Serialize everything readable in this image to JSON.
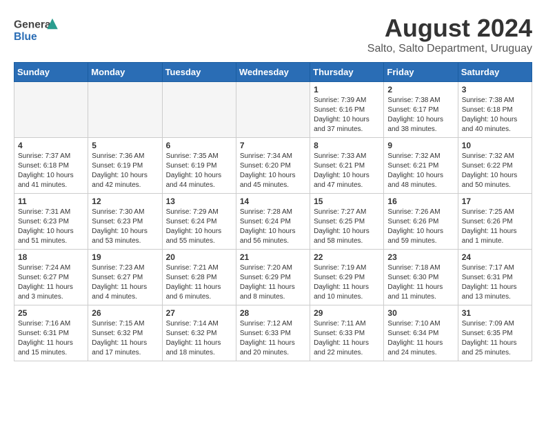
{
  "header": {
    "logo_general": "General",
    "logo_blue": "Blue",
    "title": "August 2024",
    "subtitle": "Salto, Salto Department, Uruguay"
  },
  "weekdays": [
    "Sunday",
    "Monday",
    "Tuesday",
    "Wednesday",
    "Thursday",
    "Friday",
    "Saturday"
  ],
  "weeks": [
    [
      {
        "day": "",
        "info": ""
      },
      {
        "day": "",
        "info": ""
      },
      {
        "day": "",
        "info": ""
      },
      {
        "day": "",
        "info": ""
      },
      {
        "day": "1",
        "info": "Sunrise: 7:39 AM\nSunset: 6:16 PM\nDaylight: 10 hours\nand 37 minutes."
      },
      {
        "day": "2",
        "info": "Sunrise: 7:38 AM\nSunset: 6:17 PM\nDaylight: 10 hours\nand 38 minutes."
      },
      {
        "day": "3",
        "info": "Sunrise: 7:38 AM\nSunset: 6:18 PM\nDaylight: 10 hours\nand 40 minutes."
      }
    ],
    [
      {
        "day": "4",
        "info": "Sunrise: 7:37 AM\nSunset: 6:18 PM\nDaylight: 10 hours\nand 41 minutes."
      },
      {
        "day": "5",
        "info": "Sunrise: 7:36 AM\nSunset: 6:19 PM\nDaylight: 10 hours\nand 42 minutes."
      },
      {
        "day": "6",
        "info": "Sunrise: 7:35 AM\nSunset: 6:19 PM\nDaylight: 10 hours\nand 44 minutes."
      },
      {
        "day": "7",
        "info": "Sunrise: 7:34 AM\nSunset: 6:20 PM\nDaylight: 10 hours\nand 45 minutes."
      },
      {
        "day": "8",
        "info": "Sunrise: 7:33 AM\nSunset: 6:21 PM\nDaylight: 10 hours\nand 47 minutes."
      },
      {
        "day": "9",
        "info": "Sunrise: 7:32 AM\nSunset: 6:21 PM\nDaylight: 10 hours\nand 48 minutes."
      },
      {
        "day": "10",
        "info": "Sunrise: 7:32 AM\nSunset: 6:22 PM\nDaylight: 10 hours\nand 50 minutes."
      }
    ],
    [
      {
        "day": "11",
        "info": "Sunrise: 7:31 AM\nSunset: 6:23 PM\nDaylight: 10 hours\nand 51 minutes."
      },
      {
        "day": "12",
        "info": "Sunrise: 7:30 AM\nSunset: 6:23 PM\nDaylight: 10 hours\nand 53 minutes."
      },
      {
        "day": "13",
        "info": "Sunrise: 7:29 AM\nSunset: 6:24 PM\nDaylight: 10 hours\nand 55 minutes."
      },
      {
        "day": "14",
        "info": "Sunrise: 7:28 AM\nSunset: 6:24 PM\nDaylight: 10 hours\nand 56 minutes."
      },
      {
        "day": "15",
        "info": "Sunrise: 7:27 AM\nSunset: 6:25 PM\nDaylight: 10 hours\nand 58 minutes."
      },
      {
        "day": "16",
        "info": "Sunrise: 7:26 AM\nSunset: 6:26 PM\nDaylight: 10 hours\nand 59 minutes."
      },
      {
        "day": "17",
        "info": "Sunrise: 7:25 AM\nSunset: 6:26 PM\nDaylight: 11 hours\nand 1 minute."
      }
    ],
    [
      {
        "day": "18",
        "info": "Sunrise: 7:24 AM\nSunset: 6:27 PM\nDaylight: 11 hours\nand 3 minutes."
      },
      {
        "day": "19",
        "info": "Sunrise: 7:23 AM\nSunset: 6:27 PM\nDaylight: 11 hours\nand 4 minutes."
      },
      {
        "day": "20",
        "info": "Sunrise: 7:21 AM\nSunset: 6:28 PM\nDaylight: 11 hours\nand 6 minutes."
      },
      {
        "day": "21",
        "info": "Sunrise: 7:20 AM\nSunset: 6:29 PM\nDaylight: 11 hours\nand 8 minutes."
      },
      {
        "day": "22",
        "info": "Sunrise: 7:19 AM\nSunset: 6:29 PM\nDaylight: 11 hours\nand 10 minutes."
      },
      {
        "day": "23",
        "info": "Sunrise: 7:18 AM\nSunset: 6:30 PM\nDaylight: 11 hours\nand 11 minutes."
      },
      {
        "day": "24",
        "info": "Sunrise: 7:17 AM\nSunset: 6:31 PM\nDaylight: 11 hours\nand 13 minutes."
      }
    ],
    [
      {
        "day": "25",
        "info": "Sunrise: 7:16 AM\nSunset: 6:31 PM\nDaylight: 11 hours\nand 15 minutes."
      },
      {
        "day": "26",
        "info": "Sunrise: 7:15 AM\nSunset: 6:32 PM\nDaylight: 11 hours\nand 17 minutes."
      },
      {
        "day": "27",
        "info": "Sunrise: 7:14 AM\nSunset: 6:32 PM\nDaylight: 11 hours\nand 18 minutes."
      },
      {
        "day": "28",
        "info": "Sunrise: 7:12 AM\nSunset: 6:33 PM\nDaylight: 11 hours\nand 20 minutes."
      },
      {
        "day": "29",
        "info": "Sunrise: 7:11 AM\nSunset: 6:33 PM\nDaylight: 11 hours\nand 22 minutes."
      },
      {
        "day": "30",
        "info": "Sunrise: 7:10 AM\nSunset: 6:34 PM\nDaylight: 11 hours\nand 24 minutes."
      },
      {
        "day": "31",
        "info": "Sunrise: 7:09 AM\nSunset: 6:35 PM\nDaylight: 11 hours\nand 25 minutes."
      }
    ]
  ]
}
